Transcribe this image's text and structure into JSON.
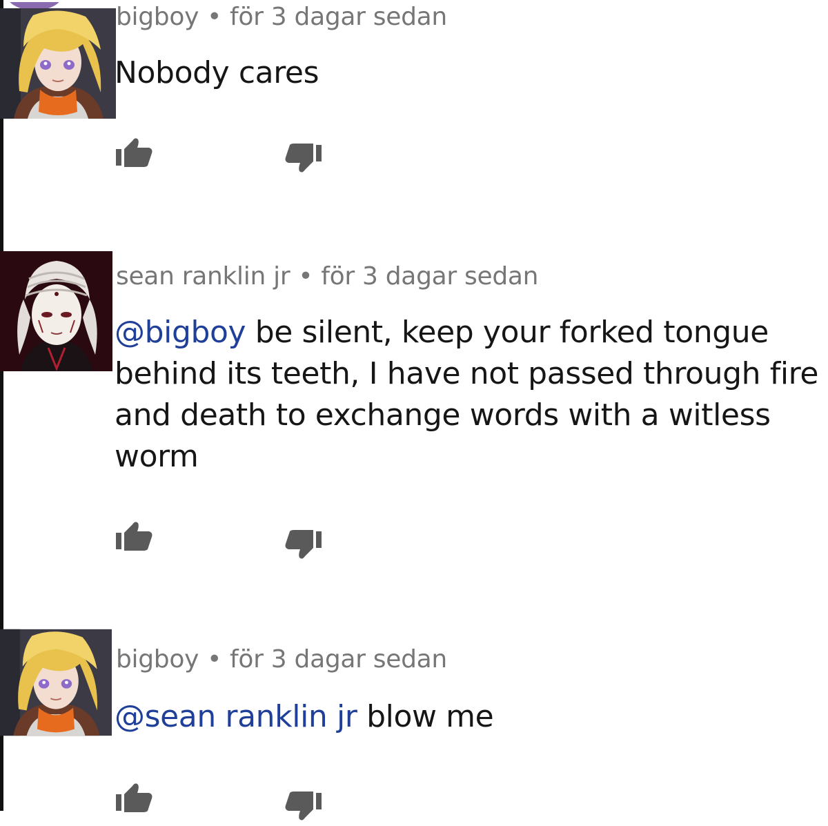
{
  "comments": [
    {
      "author": "bigboy",
      "separator": "•",
      "time": "för 3 dagar sedan",
      "mention": "",
      "text": "Nobody cares",
      "avatar": "blonde-anime-girl-avatar"
    },
    {
      "author": "sean ranklin jr",
      "separator": "•",
      "time": "för 3 dagar sedan",
      "mention": "@bigboy",
      "text": " be silent, keep your forked tongue behind its teeth, I have not passed through fire and death to exchange words with a witless worm",
      "avatar": "white-haired-anime-avatar"
    },
    {
      "author": "bigboy",
      "separator": "•",
      "time": "för 3 dagar sedan",
      "mention": "@sean ranklin jr",
      "text": " blow me",
      "avatar": "blonde-anime-girl-avatar"
    }
  ],
  "icons": {
    "like": "thumbs-up-icon",
    "dislike": "thumbs-down-icon"
  },
  "colors": {
    "meta_text": "#767676",
    "mention": "#1f3f99",
    "icon": "#5a5a5a",
    "body_text": "#161616"
  }
}
